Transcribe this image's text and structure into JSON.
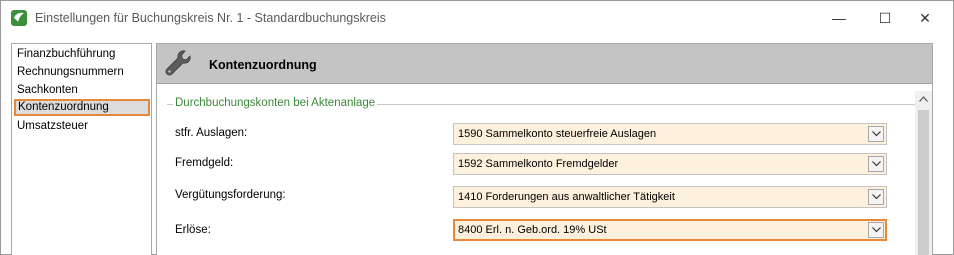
{
  "window": {
    "title": "Einstellungen für Buchungskreis Nr. 1 - Standardbuchungskreis",
    "minimize_glyph": "—",
    "maximize_glyph": "☐",
    "close_glyph": "✕"
  },
  "sidebar": {
    "items": [
      {
        "label": "Finanzbuchführung",
        "active": false
      },
      {
        "label": "Rechnungsnummern",
        "active": false
      },
      {
        "label": "Sachkonten",
        "active": false
      },
      {
        "label": "Kontenzuordnung",
        "active": true
      },
      {
        "label": "Umsatzsteuer",
        "active": false
      }
    ]
  },
  "panel": {
    "title": "Kontenzuordnung",
    "icon": "wrench-icon",
    "group_label": "Durchbuchungskonten bei Aktenanlage",
    "rows": [
      {
        "label": "stfr. Auslagen:",
        "value": "1590  Sammelkonto steuerfreie Auslagen"
      },
      {
        "label": "Fremdgeld:",
        "value": "1592  Sammelkonto Fremdgelder"
      },
      {
        "label": "Vergütungsforderung:",
        "value": "1410  Forderungen aus anwaltlicher Tätigkeit"
      },
      {
        "label": "Erlöse:",
        "value": "8400  Erl. n. Geb.ord. 19% USt",
        "focused": true
      }
    ]
  },
  "colors": {
    "accent_orange": "#e8883a",
    "combo_background": "#fdf0dc",
    "group_label_green": "#3a8a3a",
    "header_gray": "#c4c4c4"
  }
}
